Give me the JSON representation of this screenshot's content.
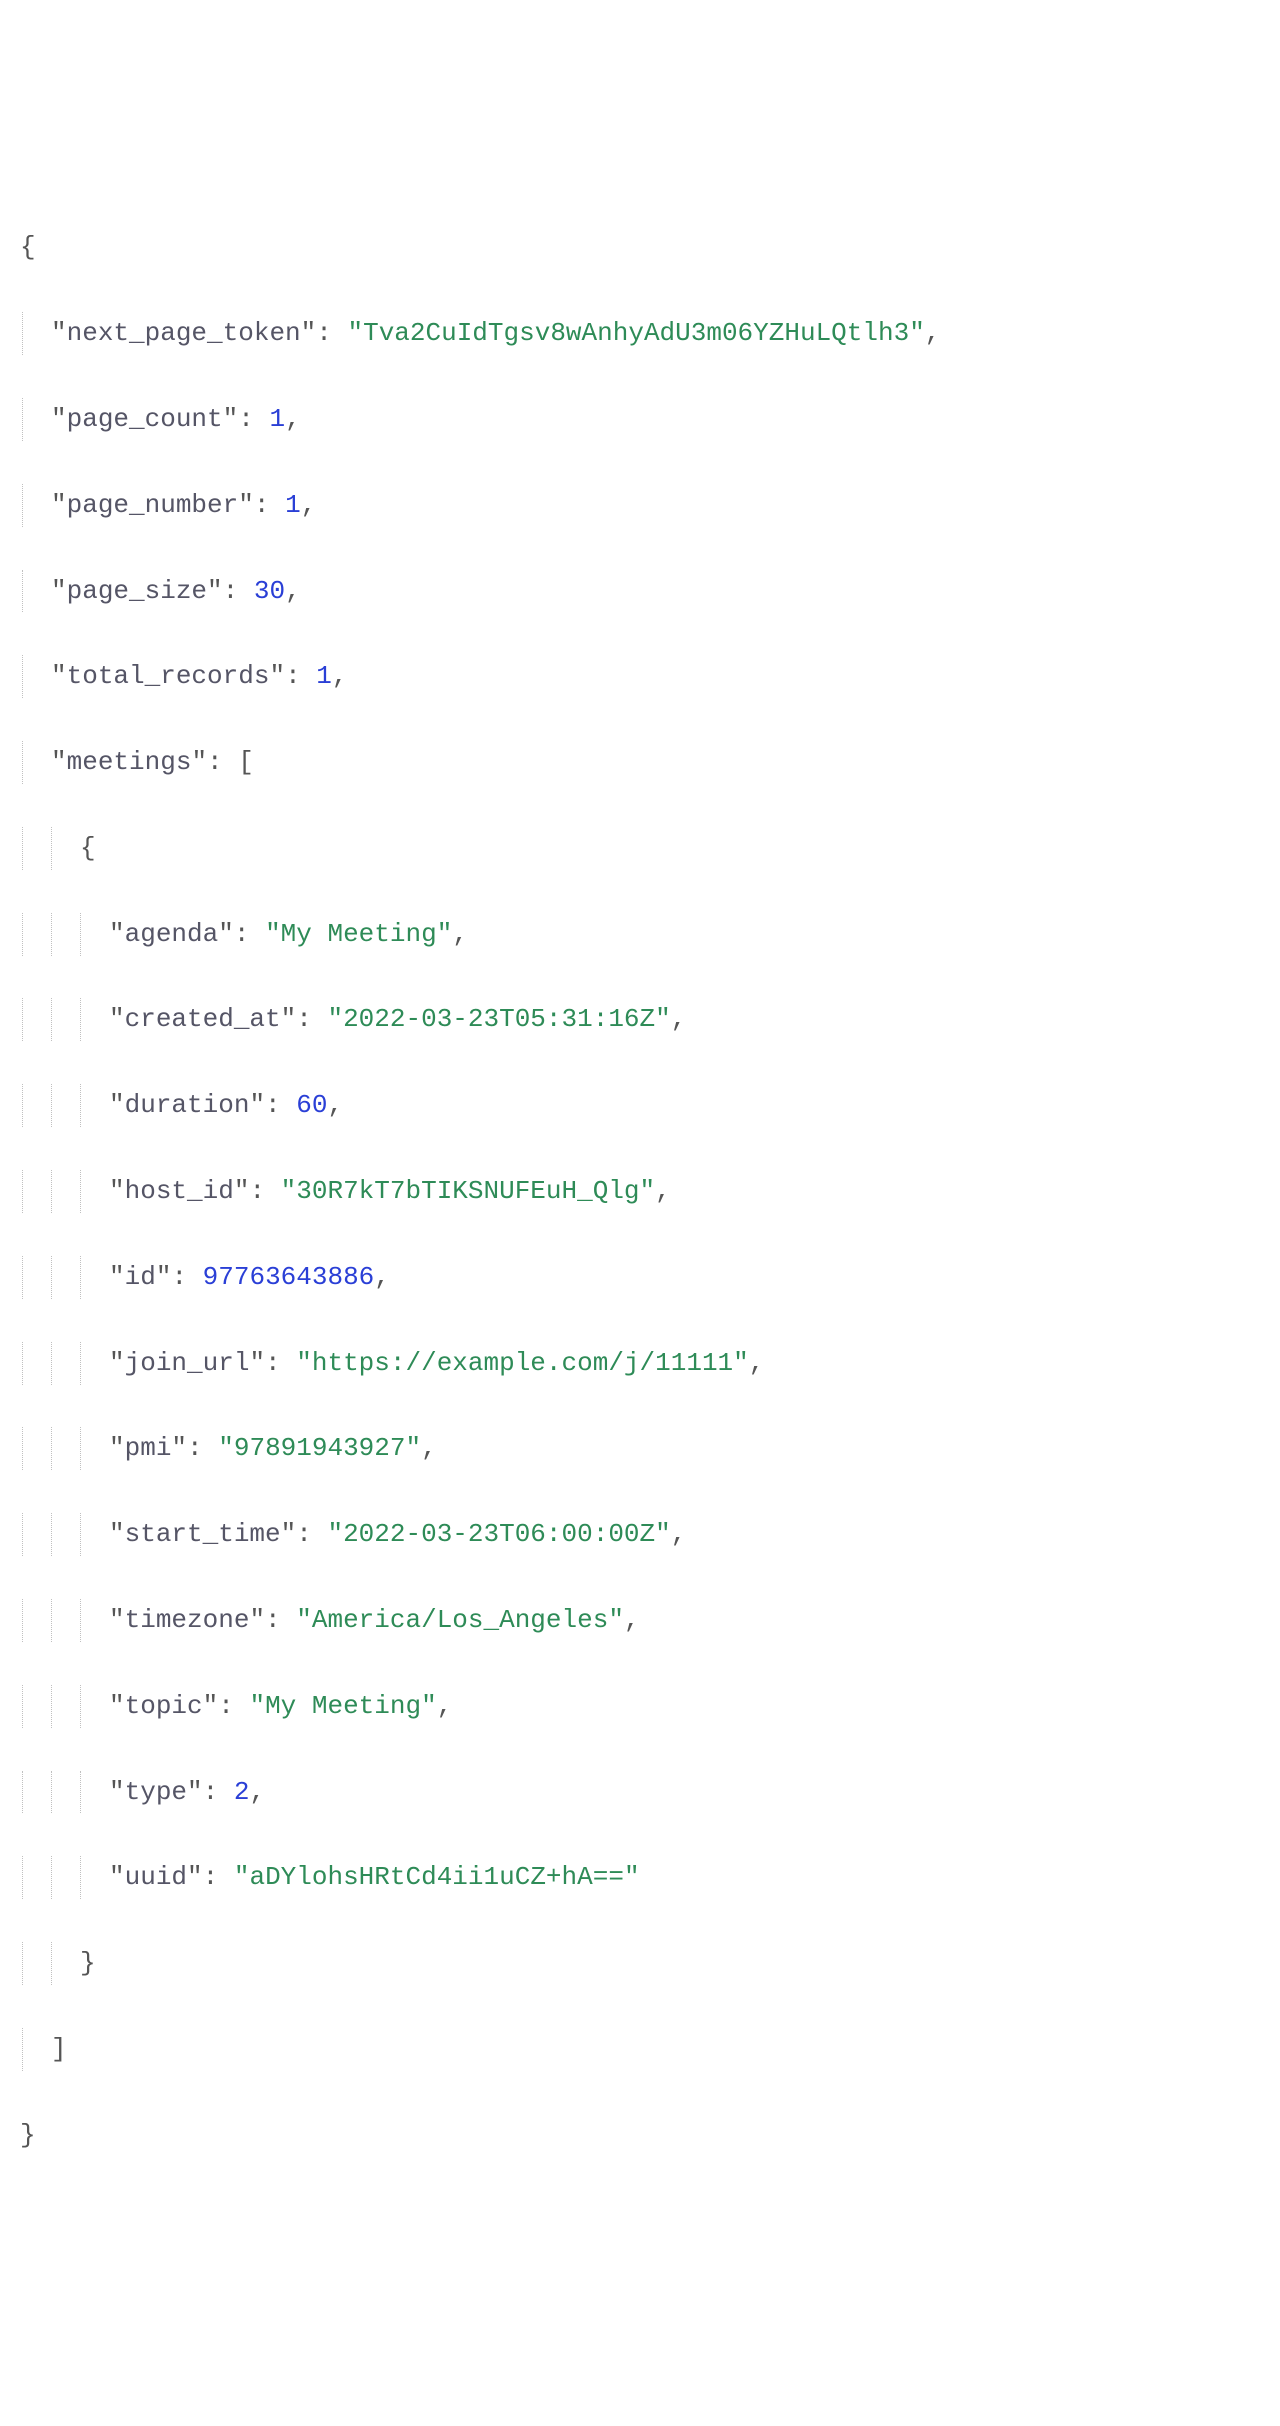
{
  "json": {
    "top": {
      "next_page_token": {
        "key": "next_page_token",
        "value": "Tva2CuIdTgsv8wAnhyAdU3m06YZHuLQtlh3",
        "type": "string"
      },
      "page_count": {
        "key": "page_count",
        "value": "1",
        "type": "number"
      },
      "page_number": {
        "key": "page_number",
        "value": "1",
        "type": "number"
      },
      "page_size": {
        "key": "page_size",
        "value": "30",
        "type": "number"
      },
      "total_records": {
        "key": "total_records",
        "value": "1",
        "type": "number"
      },
      "meetings_key": "meetings"
    },
    "meeting": {
      "agenda": {
        "key": "agenda",
        "value": "My Meeting",
        "type": "string"
      },
      "created_at": {
        "key": "created_at",
        "value": "2022-03-23T05:31:16Z",
        "type": "string"
      },
      "duration": {
        "key": "duration",
        "value": "60",
        "type": "number"
      },
      "host_id": {
        "key": "host_id",
        "value": "30R7kT7bTIKSNUFEuH_Qlg",
        "type": "string"
      },
      "id": {
        "key": "id",
        "value": "97763643886",
        "type": "number"
      },
      "join_url": {
        "key": "join_url",
        "value": "https://example.com/j/11111",
        "type": "string"
      },
      "pmi": {
        "key": "pmi",
        "value": "97891943927",
        "type": "string"
      },
      "start_time": {
        "key": "start_time",
        "value": "2022-03-23T06:00:00Z",
        "type": "string"
      },
      "timezone": {
        "key": "timezone",
        "value": "America/Los_Angeles",
        "type": "string"
      },
      "topic": {
        "key": "topic",
        "value": "My Meeting",
        "type": "string"
      },
      "type": {
        "key": "type",
        "value": "2",
        "type": "number"
      },
      "uuid": {
        "key": "uuid",
        "value": "aDYlohsHRtCd4ii1uCZ+hA==",
        "type": "string"
      }
    }
  },
  "punct": {
    "open_brace": "{",
    "close_brace": "}",
    "open_bracket": "[",
    "close_bracket": "]",
    "colon_sp": ": ",
    "comma": ",",
    "quote": "\""
  }
}
